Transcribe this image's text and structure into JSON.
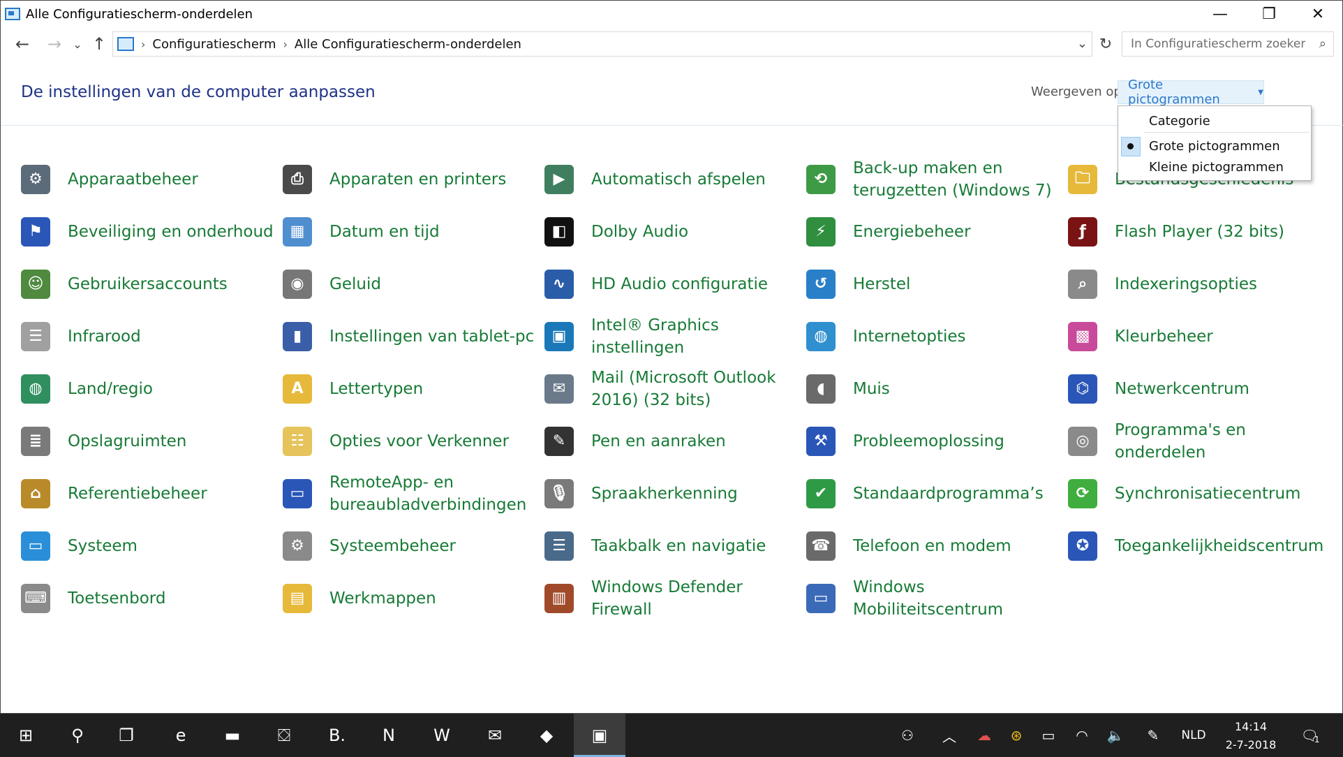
{
  "window": {
    "title": "Alle Configuratiescherm-onderdelen",
    "minimize_symbol": "—",
    "maximize_symbol": "❐",
    "close_symbol": "✕"
  },
  "nav": {
    "back_symbol": "←",
    "forward_symbol": "→",
    "recent_symbol": "⌄",
    "up_symbol": "↑",
    "breadcrumbs": [
      "Configuratiescherm",
      "Alle Configuratiescherm-onderdelen"
    ],
    "separator": "›",
    "refresh_symbol": "↻",
    "dropdown_symbol": "⌄",
    "search_placeholder": "In Configuratiescherm zoeken",
    "search_symbol": "⌕"
  },
  "header": {
    "title": "De instellingen van de computer aanpassen",
    "view_label": "Weergeven op:",
    "view_value": "Grote pictogrammen",
    "caret": "▼"
  },
  "menu": {
    "items": [
      "Categorie",
      "Grote pictogrammen",
      "Kleine pictogrammen"
    ],
    "selected_index": 1
  },
  "items": [
    {
      "label": "Apparaatbeheer",
      "icon": "device-manager-icon",
      "glyph": "⚙",
      "color": "#5b6b7a"
    },
    {
      "label": "Apparaten en printers",
      "icon": "printer-icon",
      "glyph": "⎙",
      "color": "#4a4a4a"
    },
    {
      "label": "Automatisch afspelen",
      "icon": "autoplay-icon",
      "glyph": "▶",
      "color": "#3f7f5f"
    },
    {
      "label": "Back-up maken en terugzetten (Windows 7)",
      "icon": "backup-icon",
      "glyph": "⟲",
      "color": "#3f9a46"
    },
    {
      "label": "Bestandsgeschiedenis",
      "icon": "file-history-icon",
      "glyph": "🗀",
      "color": "#e6b93b"
    },
    {
      "label": "Beveiliging en onderhoud",
      "icon": "security-flag-icon",
      "glyph": "⚑",
      "color": "#2a56b8"
    },
    {
      "label": "Datum en tijd",
      "icon": "calendar-clock-icon",
      "glyph": "▦",
      "color": "#4f8fcf"
    },
    {
      "label": "Dolby Audio",
      "icon": "dolby-icon",
      "glyph": "◧",
      "color": "#111111"
    },
    {
      "label": "Energiebeheer",
      "icon": "power-battery-icon",
      "glyph": "⚡",
      "color": "#2f8f3f"
    },
    {
      "label": "Flash Player (32 bits)",
      "icon": "flash-icon",
      "glyph": "ƒ",
      "color": "#7a1414"
    },
    {
      "label": "Gebruikersaccounts",
      "icon": "users-icon",
      "glyph": "☺",
      "color": "#4f8a3f"
    },
    {
      "label": "Geluid",
      "icon": "speaker-icon",
      "glyph": "◉",
      "color": "#777777"
    },
    {
      "label": "HD Audio configuratie",
      "icon": "hd-audio-icon",
      "glyph": "∿",
      "color": "#2a5da8"
    },
    {
      "label": "Herstel",
      "icon": "recovery-icon",
      "glyph": "↺",
      "color": "#2a7fc9"
    },
    {
      "label": "Indexeringsopties",
      "icon": "indexing-icon",
      "glyph": "⌕",
      "color": "#8a8a8a"
    },
    {
      "label": "Infrarood",
      "icon": "infrared-icon",
      "glyph": "☰",
      "color": "#a0a0a0"
    },
    {
      "label": "Instellingen van tablet-pc",
      "icon": "tablet-icon",
      "glyph": "▮",
      "color": "#3a5fa8"
    },
    {
      "label": "Intel® Graphics instellingen",
      "icon": "intel-graphics-icon",
      "glyph": "▣",
      "color": "#1a78b8"
    },
    {
      "label": "Internetopties",
      "icon": "internet-options-icon",
      "glyph": "◍",
      "color": "#2f8fcf"
    },
    {
      "label": "Kleurbeheer",
      "icon": "color-management-icon",
      "glyph": "▩",
      "color": "#c94a9a"
    },
    {
      "label": "Land/regio",
      "icon": "globe-clock-icon",
      "glyph": "◍",
      "color": "#2f8f5f"
    },
    {
      "label": "Lettertypen",
      "icon": "fonts-folder-icon",
      "glyph": "A",
      "color": "#e6b93b"
    },
    {
      "label": "Mail (Microsoft Outlook 2016) (32 bits)",
      "icon": "mail-icon",
      "glyph": "✉",
      "color": "#6a7a8a"
    },
    {
      "label": "Muis",
      "icon": "mouse-icon",
      "glyph": "◖",
      "color": "#6a6a6a"
    },
    {
      "label": "Netwerkcentrum",
      "icon": "network-icon",
      "glyph": "⌬",
      "color": "#2a56b8"
    },
    {
      "label": "Opslagruimten",
      "icon": "storage-icon",
      "glyph": "≣",
      "color": "#7a7a7a"
    },
    {
      "label": "Opties voor Verkenner",
      "icon": "explorer-options-icon",
      "glyph": "☷",
      "color": "#e6c35b"
    },
    {
      "label": "Pen en aanraken",
      "icon": "pen-icon",
      "glyph": "✎",
      "color": "#333333"
    },
    {
      "label": "Probleemoplossing",
      "icon": "troubleshooting-icon",
      "glyph": "⚒",
      "color": "#2a56b8"
    },
    {
      "label": "Programma's en onderdelen",
      "icon": "programs-icon",
      "glyph": "◎",
      "color": "#8a8a8a"
    },
    {
      "label": "Referentiebeheer",
      "icon": "credential-vault-icon",
      "glyph": "⌂",
      "color": "#b88a2a"
    },
    {
      "label": "RemoteApp- en bureaubladverbindingen",
      "icon": "remoteapp-icon",
      "glyph": "▭",
      "color": "#2a56b8"
    },
    {
      "label": "Spraakherkenning",
      "icon": "microphone-icon",
      "glyph": "🎙",
      "color": "#7a7a7a"
    },
    {
      "label": "Standaardprogramma’s",
      "icon": "default-programs-icon",
      "glyph": "✔",
      "color": "#2f9a46"
    },
    {
      "label": "Synchronisatiecentrum",
      "icon": "sync-icon",
      "glyph": "⟳",
      "color": "#3fae3f"
    },
    {
      "label": "Systeem",
      "icon": "computer-icon",
      "glyph": "▭",
      "color": "#2a8fd8"
    },
    {
      "label": "Systeembeheer",
      "icon": "admin-tools-icon",
      "glyph": "⚙",
      "color": "#8a8a8a"
    },
    {
      "label": "Taakbalk en navigatie",
      "icon": "taskbar-icon",
      "glyph": "☰",
      "color": "#4a6a8a"
    },
    {
      "label": "Telefoon en modem",
      "icon": "phone-modem-icon",
      "glyph": "☎",
      "color": "#6a6a6a"
    },
    {
      "label": "Toegankelijkheidscentrum",
      "icon": "accessibility-icon",
      "glyph": "✪",
      "color": "#2a56b8"
    },
    {
      "label": "Toetsenbord",
      "icon": "keyboard-icon",
      "glyph": "⌨",
      "color": "#8a8a8a"
    },
    {
      "label": "Werkmappen",
      "icon": "work-folders-icon",
      "glyph": "▤",
      "color": "#e6b93b"
    },
    {
      "label": "Windows Defender Firewall",
      "icon": "firewall-icon",
      "glyph": "▥",
      "color": "#a04a2a"
    },
    {
      "label": "Windows Mobiliteitscentrum",
      "icon": "mobility-center-icon",
      "glyph": "▭",
      "color": "#3a6ab8"
    }
  ],
  "taskbar": {
    "apps": [
      {
        "name": "start-button",
        "glyph": "⊞"
      },
      {
        "name": "search-button",
        "glyph": "⚲"
      },
      {
        "name": "task-view-button",
        "glyph": "❐"
      },
      {
        "name": "edge-app",
        "glyph": "e"
      },
      {
        "name": "file-explorer-app",
        "glyph": "▬"
      },
      {
        "name": "store-app",
        "glyph": "⛋"
      },
      {
        "name": "booking-app",
        "glyph": "B."
      },
      {
        "name": "netflix-app",
        "glyph": "N"
      },
      {
        "name": "word-app",
        "glyph": "W"
      },
      {
        "name": "mail-app",
        "glyph": "✉"
      },
      {
        "name": "paint3d-app",
        "glyph": "◆"
      },
      {
        "name": "control-panel-app",
        "glyph": "▣"
      }
    ],
    "tray": {
      "people_symbol": "⚇",
      "chevron_symbol": "︿",
      "onedrive_symbol": "☁",
      "norton_symbol": "⊛",
      "battery_symbol": "▭",
      "wifi_symbol": "◠",
      "volume_symbol": "🔈",
      "pen_symbol": "✎",
      "language": "NLD",
      "time": "14:14",
      "date": "2-7-2018",
      "notification_symbol": "🗨",
      "notification_count": "1"
    }
  }
}
